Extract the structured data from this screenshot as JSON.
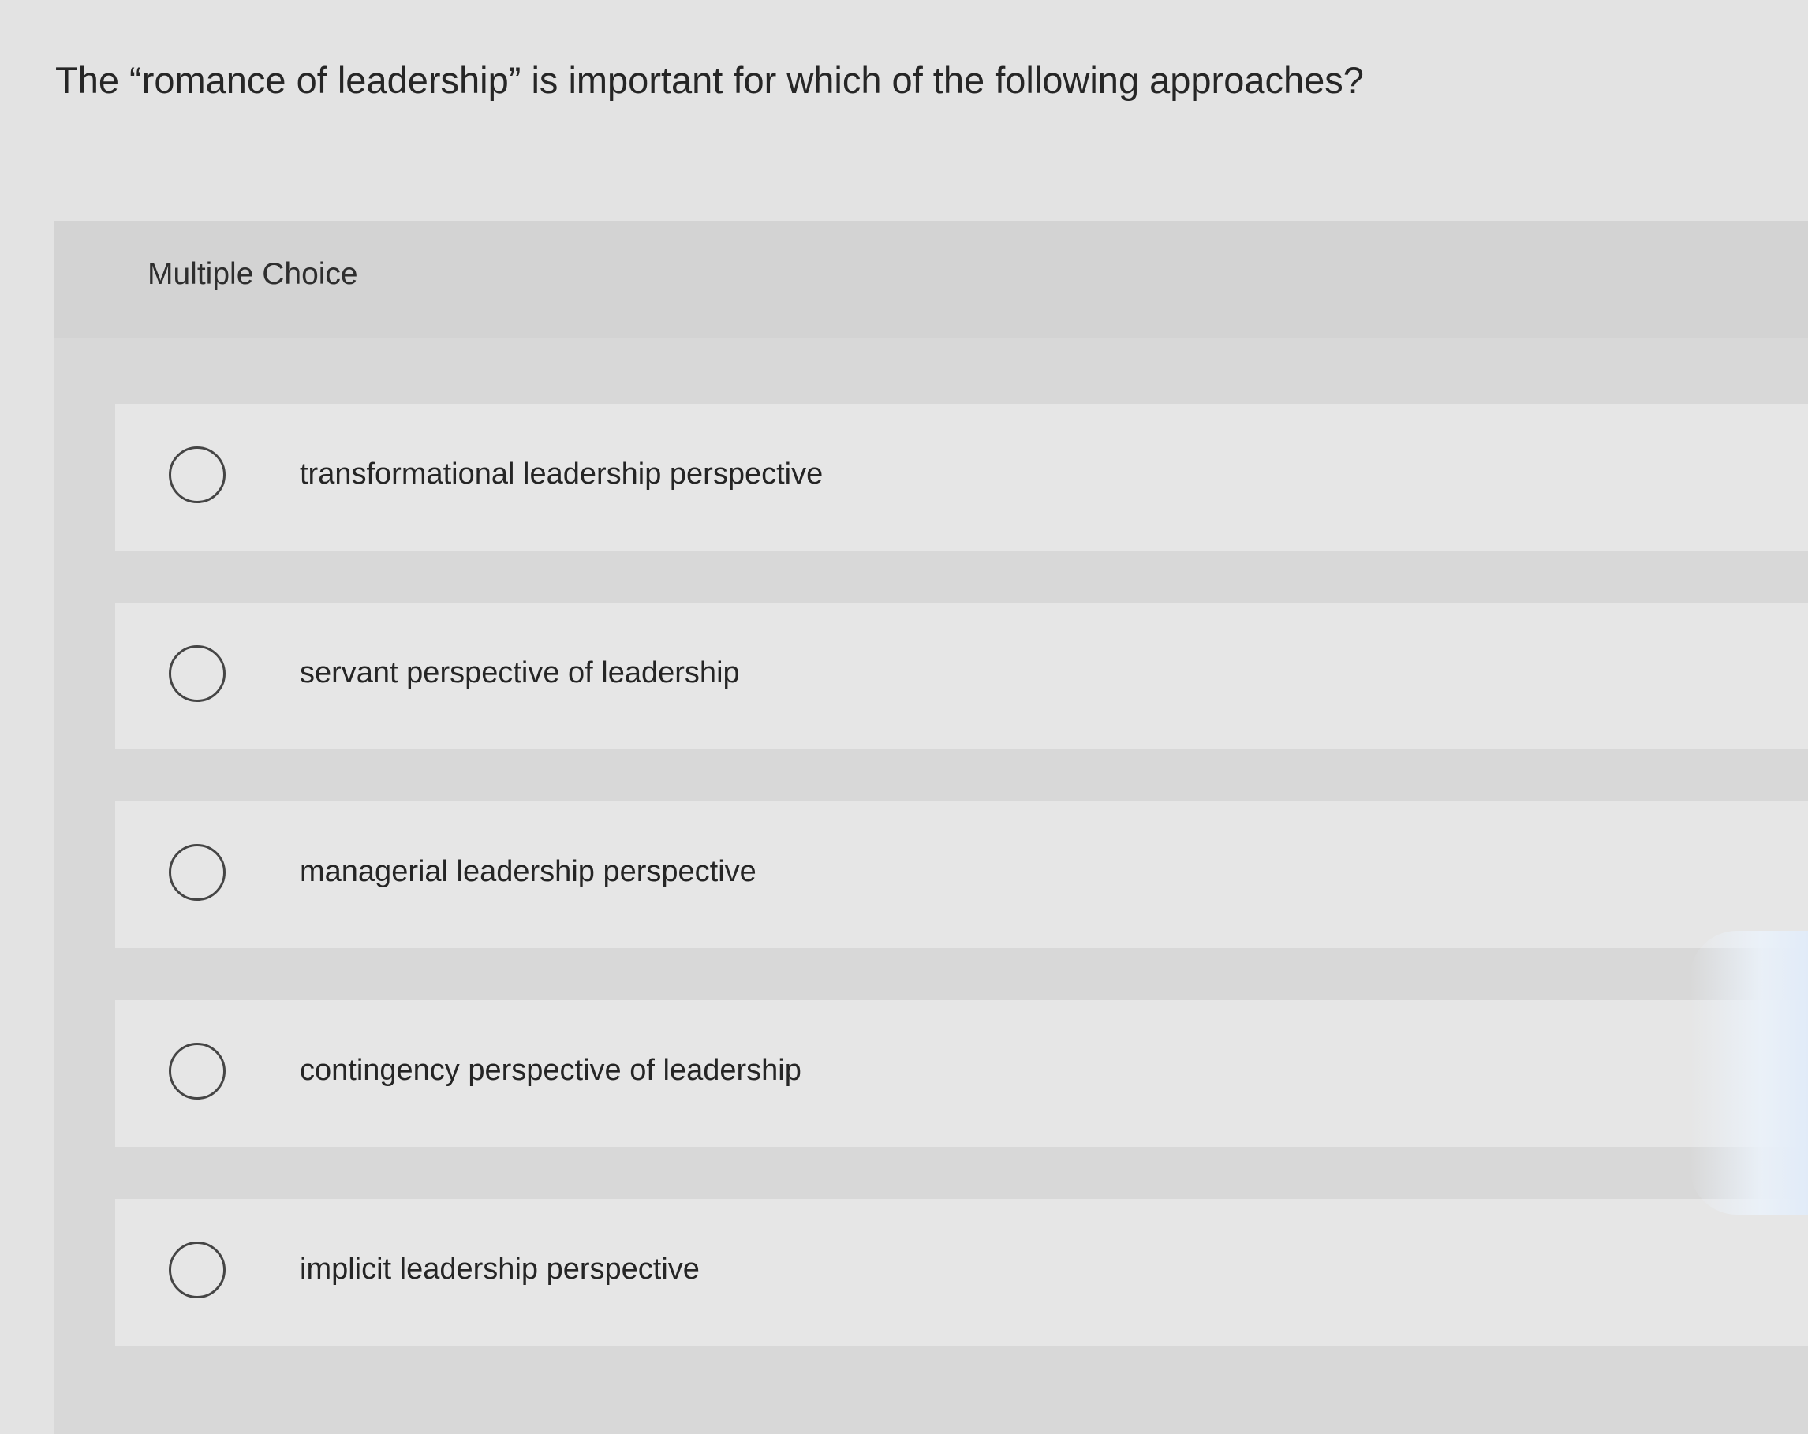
{
  "question": {
    "text": "The “romance of leadership” is important for which of the following approaches?"
  },
  "panel": {
    "label": "Multiple Choice"
  },
  "choices": [
    {
      "label": "transformational leadership perspective",
      "selected": false
    },
    {
      "label": "servant perspective of leadership",
      "selected": false
    },
    {
      "label": "managerial leadership perspective",
      "selected": false
    },
    {
      "label": "contingency perspective of leadership",
      "selected": false
    },
    {
      "label": "implicit leadership perspective",
      "selected": false
    }
  ],
  "colors": {
    "page_background": "#e3e3e3",
    "panel_background": "#d8d8d8",
    "choice_background": "#e6e6e6",
    "radio_border": "#454545",
    "text": "#262626"
  }
}
